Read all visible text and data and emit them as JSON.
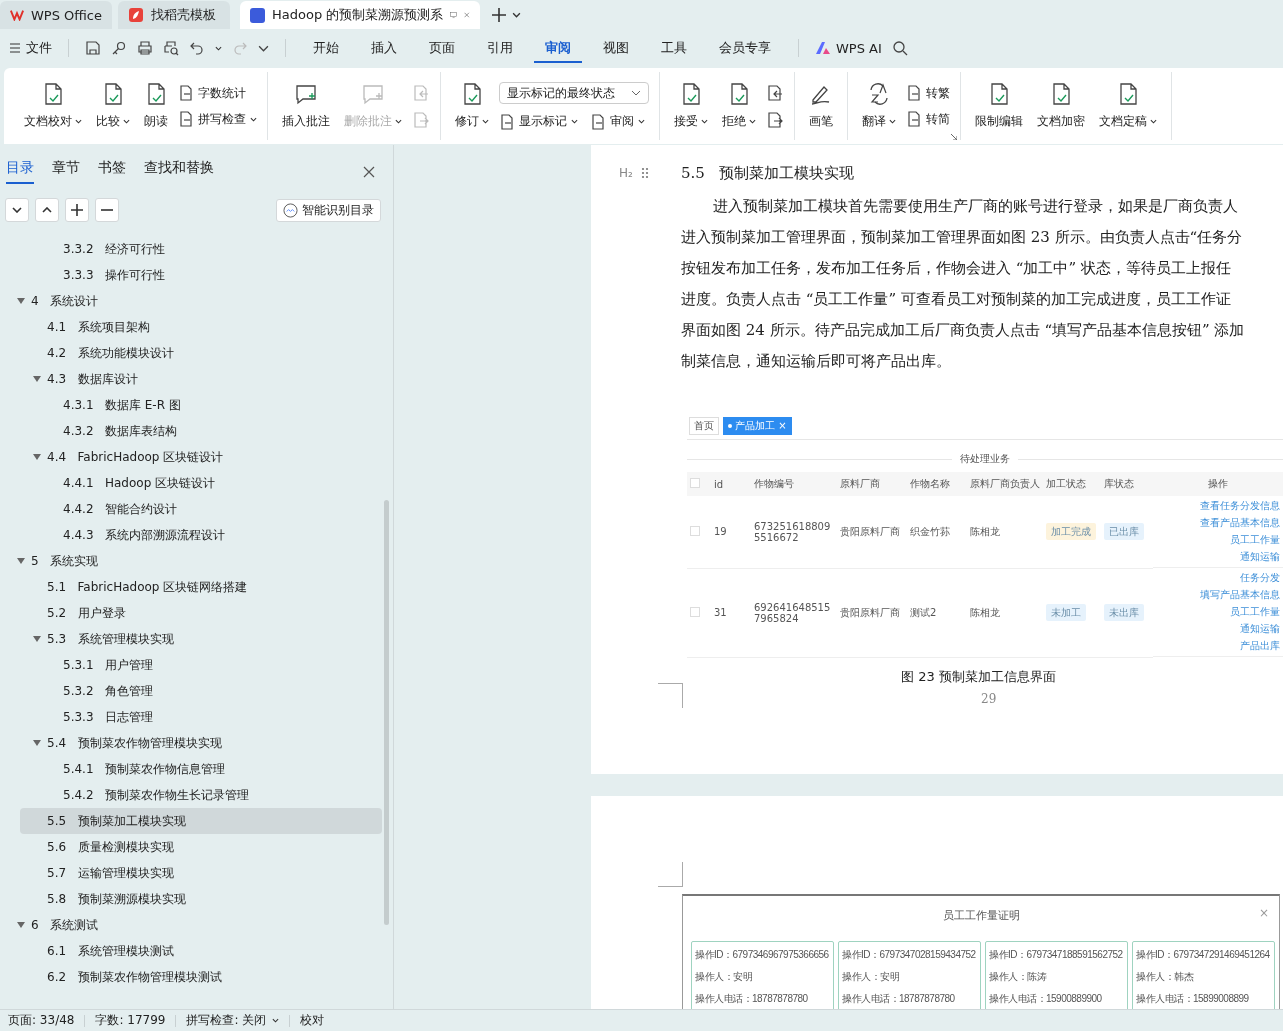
{
  "browser_tabs": [
    {
      "label": "WPS Office",
      "selected": false
    },
    {
      "label": "找稻壳模板",
      "selected": false
    },
    {
      "label": "Hadoop 的预制菜溯源预测系",
      "selected": true
    }
  ],
  "menu": {
    "file": "文件",
    "tabs": [
      {
        "label": "开始",
        "selected": false
      },
      {
        "label": "插入",
        "selected": false
      },
      {
        "label": "页面",
        "selected": false
      },
      {
        "label": "引用",
        "selected": false
      },
      {
        "label": "审阅",
        "selected": true
      },
      {
        "label": "视图",
        "selected": false
      },
      {
        "label": "工具",
        "selected": false
      },
      {
        "label": "会员专享",
        "selected": false
      }
    ],
    "ai": "WPS AI"
  },
  "ribbon": [
    {
      "launcher": false,
      "items": [
        {
          "kind": "large",
          "label": "文档校对",
          "caret": true,
          "disabled": false
        },
        {
          "kind": "large",
          "label": "比较",
          "caret": true,
          "disabled": false
        },
        {
          "kind": "large",
          "label": "朗读",
          "caret": false,
          "disabled": false
        },
        {
          "kind": "stack",
          "items": [
            {
              "label": "字数统计",
              "caret": false
            },
            {
              "label": "拼写检查",
              "caret": true
            }
          ]
        }
      ]
    },
    {
      "launcher": false,
      "items": [
        {
          "kind": "large",
          "label": "插入批注",
          "caret": false,
          "disabled": false
        },
        {
          "kind": "large",
          "label": "删除批注",
          "caret": true,
          "disabled": true
        },
        {
          "kind": "iconstack",
          "disabled": true
        }
      ]
    },
    {
      "launcher": false,
      "items": [
        {
          "kind": "large",
          "label": "修订",
          "caret": true,
          "disabled": false
        },
        {
          "kind": "markup",
          "select": "显示标记的最终状态",
          "items": [
            {
              "label": "显示标记",
              "caret": true
            },
            {
              "label": "审阅",
              "caret": true
            }
          ]
        }
      ]
    },
    {
      "launcher": false,
      "items": [
        {
          "kind": "large",
          "label": "接受",
          "caret": true,
          "disabled": false
        },
        {
          "kind": "large",
          "label": "拒绝",
          "caret": true,
          "disabled": false
        },
        {
          "kind": "iconstack",
          "disabled": false
        }
      ]
    },
    {
      "launcher": false,
      "items": [
        {
          "kind": "large",
          "label": "画笔",
          "caret": false,
          "disabled": false
        }
      ]
    },
    {
      "launcher": true,
      "items": [
        {
          "kind": "stack",
          "items": [
            {
              "label": "转繁",
              "caret": false
            },
            {
              "label": "转简",
              "caret": false
            }
          ],
          "lead": {
            "label": "翻译",
            "caret": true
          }
        }
      ]
    },
    {
      "launcher": false,
      "items": [
        {
          "kind": "large",
          "label": "限制编辑",
          "caret": false,
          "disabled": false
        },
        {
          "kind": "large",
          "label": "文档加密",
          "caret": false,
          "disabled": false
        },
        {
          "kind": "large",
          "label": "文档定稿",
          "caret": true,
          "disabled": false
        }
      ]
    }
  ],
  "toc": {
    "tabs": [
      {
        "label": "目录",
        "selected": true
      },
      {
        "label": "章节",
        "selected": false
      },
      {
        "label": "书签",
        "selected": false
      },
      {
        "label": "查找和替换",
        "selected": false
      }
    ],
    "smart_button": "智能识别目录",
    "items": [
      {
        "children": [
          {
            "children": [
              {
                "number": "3.3.2",
                "title": "经济可行性",
                "selected": false
              },
              {
                "number": "3.3.3",
                "title": "操作可行性",
                "selected": false
              }
            ]
          }
        ]
      },
      {
        "number": "4",
        "title": "系统设计",
        "selected": false,
        "expanded": true,
        "children": [
          {
            "number": "4.1",
            "title": "系统项目架构",
            "selected": false
          },
          {
            "number": "4.2",
            "title": "系统功能模块设计",
            "selected": false
          },
          {
            "number": "4.3",
            "title": "数据库设计",
            "selected": false,
            "expanded": true,
            "children": [
              {
                "number": "4.3.1",
                "title": "数据库 E-R 图",
                "selected": false
              },
              {
                "number": "4.3.2",
                "title": "数据库表结构",
                "selected": false
              }
            ]
          },
          {
            "number": "4.4",
            "title": "FabricHadoop 区块链设计",
            "selected": false,
            "expanded": true,
            "children": [
              {
                "number": "4.4.1",
                "title": "Hadoop 区块链设计",
                "selected": false
              },
              {
                "number": "4.4.2",
                "title": "智能合约设计",
                "selected": false
              },
              {
                "number": "4.4.3",
                "title": "系统内部溯源流程设计",
                "selected": false
              }
            ]
          }
        ]
      },
      {
        "number": "5",
        "title": "系统实现",
        "selected": false,
        "expanded": true,
        "children": [
          {
            "number": "5.1",
            "title": "FabricHadoop 区块链网络搭建",
            "selected": false
          },
          {
            "number": "5.2",
            "title": "用户登录",
            "selected": false
          },
          {
            "number": "5.3",
            "title": "系统管理模块实现",
            "selected": false,
            "expanded": true,
            "children": [
              {
                "number": "5.3.1",
                "title": "用户管理",
                "selected": false
              },
              {
                "number": "5.3.2",
                "title": "角色管理",
                "selected": false
              },
              {
                "number": "5.3.3",
                "title": "日志管理",
                "selected": false
              }
            ]
          },
          {
            "number": "5.4",
            "title": "预制菜农作物管理模块实现",
            "selected": false,
            "expanded": true,
            "children": [
              {
                "number": "5.4.1",
                "title": "预制菜农作物信息管理",
                "selected": false
              },
              {
                "number": "5.4.2",
                "title": "预制菜农作物生长记录管理",
                "selected": false
              }
            ]
          },
          {
            "number": "5.5",
            "title": "预制菜加工模块实现",
            "selected": true
          },
          {
            "number": "5.6",
            "title": "质量检测模块实现",
            "selected": false
          },
          {
            "number": "5.7",
            "title": "运输管理模块实现",
            "selected": false
          },
          {
            "number": "5.8",
            "title": "预制菜溯源模块实现",
            "selected": false
          }
        ]
      },
      {
        "number": "6",
        "title": "系统测试",
        "selected": false,
        "expanded": true,
        "children": [
          {
            "number": "6.1",
            "title": "系统管理模块测试",
            "selected": false
          },
          {
            "number": "6.2",
            "title": "预制菜农作物管理模块测试",
            "selected": false
          }
        ]
      }
    ]
  },
  "document": {
    "heading_marker": "H₂",
    "heading_number": "5.5",
    "heading": "预制菜加工模块实现",
    "lines": [
      "进入预制菜加工模块首先需要使用生产厂商的账号进行登录，如果是厂商负责人",
      "进入预制菜加工管理界面，预制菜加工管理界面如图 23 所示。由负责人点击“任务分",
      "按钮发布加工任务，发布加工任务后，作物会进入 “加工中” 状态，等待员工上报任",
      "进度。负责人点击 “员工工作量” 可查看员工对预制菜的加工完成进度，员工工作证",
      "界面如图 24 所示。待产品完成加工后厂商负责人点击 “填写产品基本信息按钮” 添加",
      "制菜信息，通知运输后即可将产品出库。"
    ],
    "figure1": {
      "all_checked": false,
      "breadcrumbs": [
        {
          "label": "首页",
          "selected": false
        },
        {
          "label": "产品加工",
          "selected": true
        }
      ],
      "close": "×",
      "section": "待处理业务",
      "columns": [
        "id",
        "作物编号",
        "原料厂商",
        "作物名称",
        "原料厂商负责人",
        "加工状态",
        "库状态",
        "操作"
      ],
      "rows": [
        {
          "checked": false,
          "id": "19",
          "code": "6732516188095516672",
          "vendor": "贵阳原料厂商",
          "crop": "织金竹荪",
          "owner": "陈相龙",
          "process": {
            "label": "加工完成",
            "color": "#fdf3dc"
          },
          "stock": {
            "label": "已出库",
            "color": "#e6f2fc"
          },
          "actions": [
            "查看任务分发信息",
            "查看产品基本信息",
            "员工工作量",
            "通知运输"
          ]
        },
        {
          "checked": false,
          "id": "31",
          "code": "6926416485157965824",
          "vendor": "贵阳原料厂商",
          "crop": "测试2",
          "owner": "陈相龙",
          "process": {
            "label": "未加工",
            "color": "#e6f2fc"
          },
          "stock": {
            "label": "未出库",
            "color": "#e6f2fc"
          },
          "actions": [
            "任务分发",
            "填写产品基本信息",
            "员工工作量",
            "通知运输",
            "产品出库"
          ]
        }
      ]
    },
    "caption": "图 23    预制菜加工信息界面",
    "page_number": "29",
    "figure2": {
      "title": "员工工作量证明",
      "close": "×",
      "cards": [
        [
          "操作ID：6797346967975366656",
          "操作人：安明",
          "操作人电话：18787878780"
        ],
        [
          "操作ID：6797347028159434752",
          "操作人：安明",
          "操作人电话：18787878780"
        ],
        [
          "操作ID：6797347188591562752",
          "操作人：陈涛",
          "操作人电话：15900889900"
        ],
        [
          "操作ID：6797347291469451264",
          "操作人：韩杰",
          "操作人电话：15899008899"
        ]
      ]
    }
  },
  "status_bar": {
    "page": "页面: 33/48",
    "words": "字数: 17799",
    "spell": "拼写检查: 关闭",
    "proof": "校对"
  }
}
